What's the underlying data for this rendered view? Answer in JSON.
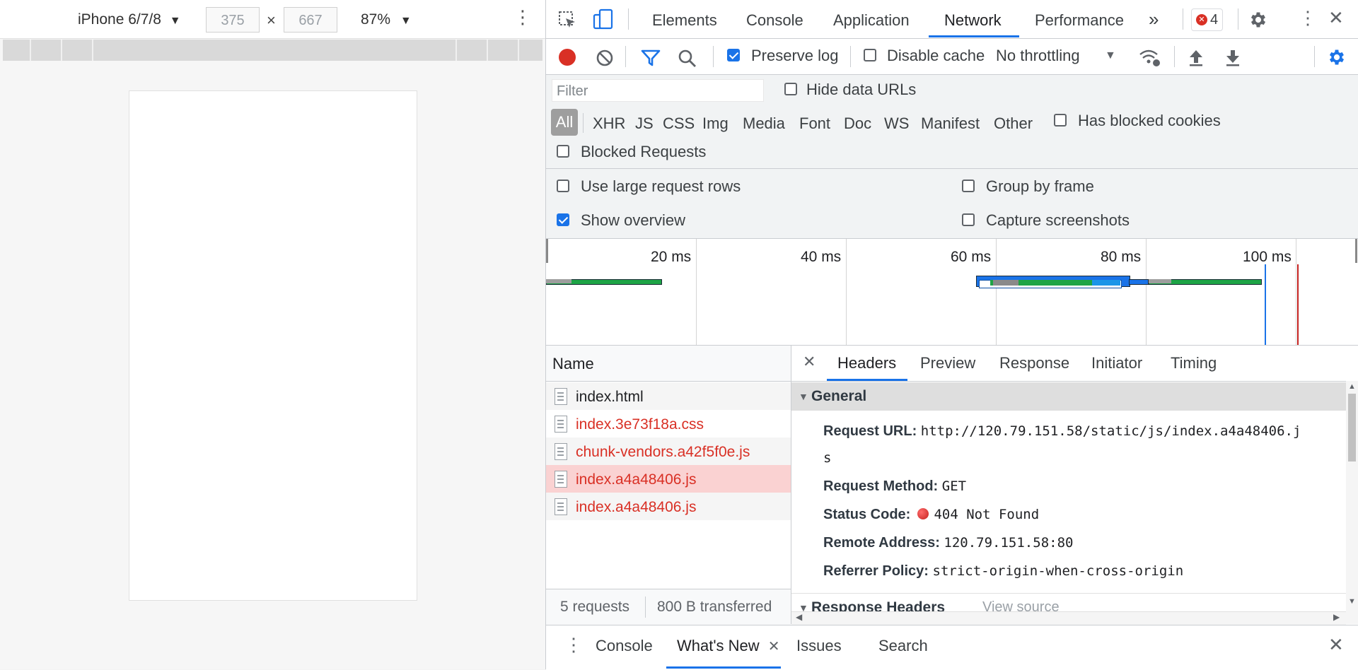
{
  "device_toolbar": {
    "device": "iPhone 6/7/8",
    "width": "375",
    "height": "667",
    "times": "×",
    "zoom": "87%"
  },
  "main_tabs": [
    "Elements",
    "Console",
    "Application",
    "Network",
    "Performance"
  ],
  "error_count": "4",
  "network_toolbar": {
    "preserve_log": "Preserve log",
    "disable_cache": "Disable cache",
    "throttling": "No throttling"
  },
  "filter": {
    "placeholder": "Filter",
    "hide_data_urls": "Hide data URLs",
    "types": [
      "All",
      "XHR",
      "JS",
      "CSS",
      "Img",
      "Media",
      "Font",
      "Doc",
      "WS",
      "Manifest",
      "Other"
    ],
    "has_blocked_cookies": "Has blocked cookies",
    "blocked_requests": "Blocked Requests"
  },
  "settings": {
    "large_rows": "Use large request rows",
    "group_by_frame": "Group by frame",
    "show_overview": "Show overview",
    "capture_screenshots": "Capture screenshots"
  },
  "overview_ticks": [
    "20 ms",
    "40 ms",
    "60 ms",
    "80 ms",
    "100 ms"
  ],
  "requests": {
    "column": "Name",
    "items": [
      "index.html",
      "index.3e73f18a.css",
      "chunk-vendors.a42f5f0e.js",
      "index.a4a48406.js",
      "index.a4a48406.js"
    ],
    "summary_count": "5 requests",
    "summary_transferred": "800 B transferred"
  },
  "detail": {
    "tabs": [
      "Headers",
      "Preview",
      "Response",
      "Initiator",
      "Timing"
    ],
    "section": "General",
    "request_url_key": "Request URL:",
    "request_url_val": "http://120.79.151.58/static/js/index.a4a48406.j",
    "request_url_wrap": "s",
    "method_key": "Request Method:",
    "method_val": "GET",
    "status_key": "Status Code:",
    "status_val": "404 Not Found",
    "remote_key": "Remote Address:",
    "remote_val": "120.79.151.58:80",
    "referrer_key": "Referrer Policy:",
    "referrer_val": "strict-origin-when-cross-origin",
    "next_section": "Response Headers",
    "view_source": "View source"
  },
  "drawer_tabs": [
    "Console",
    "What's New",
    "Issues",
    "Search"
  ],
  "colors": {
    "accent": "#1a73e8",
    "error_text": "#d93025",
    "selected_row": "#fad2d2"
  }
}
